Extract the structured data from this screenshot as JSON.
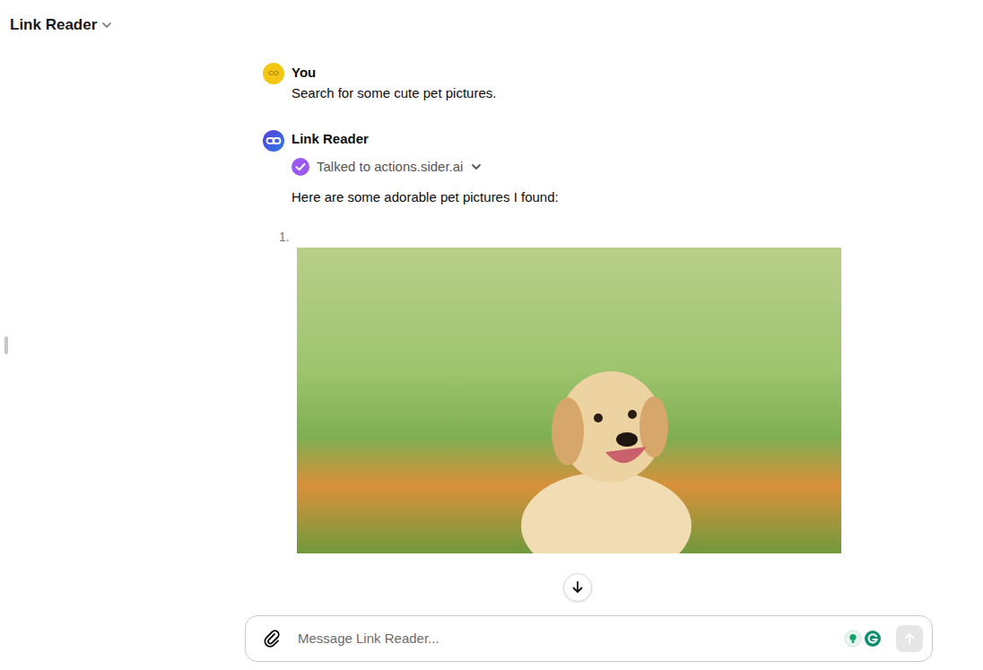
{
  "header": {
    "title": "Link Reader"
  },
  "messages": [
    {
      "author": "You",
      "avatar": "CO",
      "text": "Search for some cute pet pictures."
    },
    {
      "author": "Link Reader",
      "tool": {
        "label": "Talked to actions.sider.ai",
        "expanded": false
      },
      "text": "Here are some adorable pet pictures I found:",
      "list": [
        {
          "number": "1."
        }
      ]
    }
  ],
  "composer": {
    "placeholder": "Message Link Reader..."
  }
}
